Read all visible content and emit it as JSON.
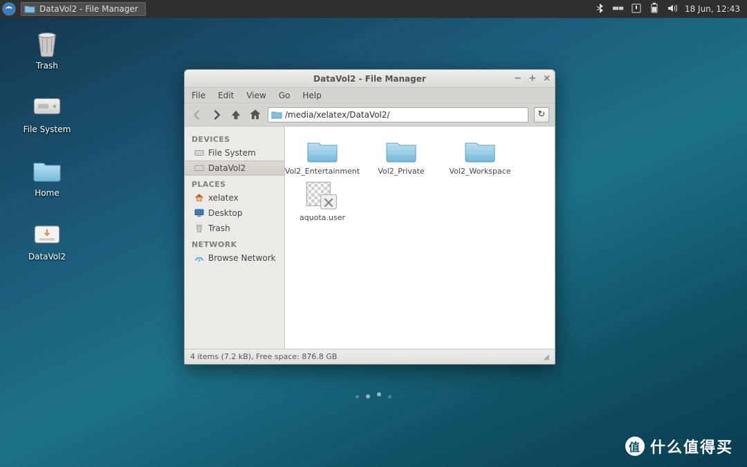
{
  "panel": {
    "task_title": "DataVol2 - File Manager",
    "clock": "18 Jun, 12:43"
  },
  "desktop": {
    "trash": "Trash",
    "filesystem": "File System",
    "home": "Home",
    "datavol2": "DataVol2"
  },
  "window": {
    "title": "DataVol2 - File Manager",
    "menus": {
      "file": "File",
      "edit": "Edit",
      "view": "View",
      "go": "Go",
      "help": "Help"
    },
    "path": "/media/xelatex/DataVol2/",
    "sidebar": {
      "devices_hdr": "DEVICES",
      "devices": [
        {
          "label": "File System"
        },
        {
          "label": "DataVol2"
        }
      ],
      "places_hdr": "PLACES",
      "places": [
        {
          "label": "xelatex"
        },
        {
          "label": "Desktop"
        },
        {
          "label": "Trash"
        }
      ],
      "network_hdr": "NETWORK",
      "network": [
        {
          "label": "Browse Network"
        }
      ]
    },
    "items": [
      {
        "label": "Vol2_Entertainment",
        "type": "folder"
      },
      {
        "label": "Vol2_Private",
        "type": "folder"
      },
      {
        "label": "Vol2_Workspace",
        "type": "folder"
      },
      {
        "label": "aquota.user",
        "type": "file-broken"
      }
    ],
    "status": "4 items (7.2 kB), Free space: 876.8 GB"
  },
  "watermark": "什么值得买"
}
